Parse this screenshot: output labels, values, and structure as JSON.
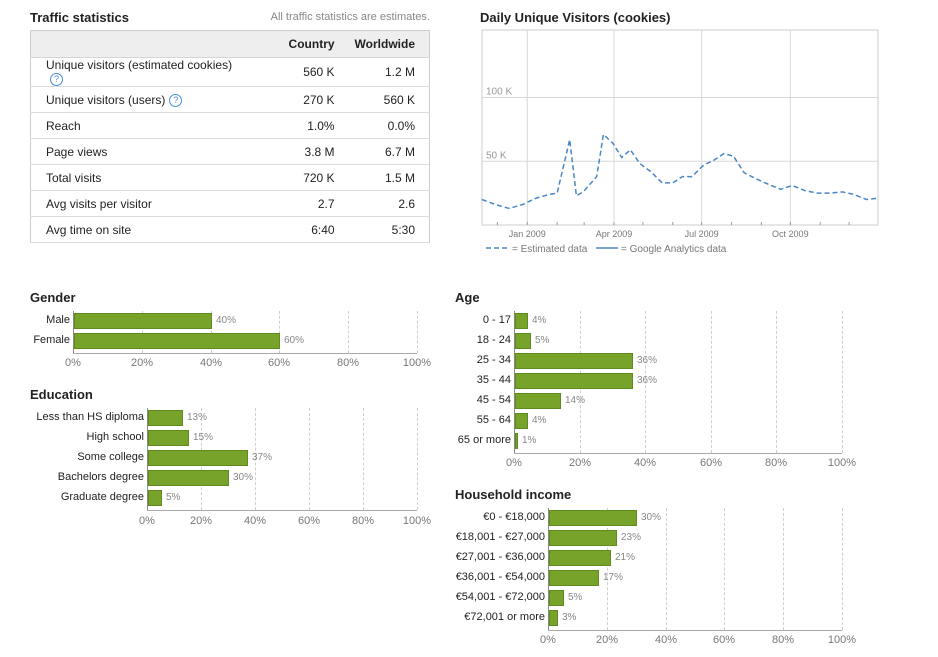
{
  "traffic": {
    "title": "Traffic statistics",
    "note": "All traffic statistics are estimates.",
    "columns": [
      "Country",
      "Worldwide"
    ],
    "rows": [
      {
        "label": "Unique visitors (estimated cookies)",
        "help": true,
        "country": "560 K",
        "worldwide": "1.2 M"
      },
      {
        "label": "Unique visitors (users)",
        "help": true,
        "country": "270 K",
        "worldwide": "560 K"
      },
      {
        "label": "Reach",
        "help": false,
        "country": "1.0%",
        "worldwide": "0.0%"
      },
      {
        "label": "Page views",
        "help": false,
        "country": "3.8 M",
        "worldwide": "6.7 M"
      },
      {
        "label": "Total visits",
        "help": false,
        "country": "720 K",
        "worldwide": "1.5 M"
      },
      {
        "label": "Avg visits per visitor",
        "help": false,
        "country": "2.7",
        "worldwide": "2.6"
      },
      {
        "label": "Avg time on site",
        "help": false,
        "country": "6:40",
        "worldwide": "5:30"
      }
    ],
    "help_icon": "question-mark-icon"
  },
  "colors": {
    "bar": "#77a32a",
    "line": "#4a86c5",
    "grid": "#cfcfcf"
  },
  "chart_data": [
    {
      "id": "daily-visitors",
      "type": "line",
      "title": "Daily Unique Visitors (cookies)",
      "y_tick_labels": [
        "50 K",
        "100 K"
      ],
      "y_ticks": [
        50,
        100
      ],
      "ylim": [
        0,
        153
      ],
      "x_tick_labels": [
        "Jan 2009",
        "Apr 2009",
        "Jul 2009",
        "Oct 2009"
      ],
      "x_ticks": [
        "2009-01-01",
        "2009-04-01",
        "2009-07-01",
        "2009-10-01"
      ],
      "x_range": [
        "2008-11-15",
        "2009-12-31"
      ],
      "grid": true,
      "legend": [
        "= Estimated data",
        "= Google Analytics data"
      ],
      "series": [
        {
          "name": "= Estimated data",
          "style": "dashed",
          "points": [
            [
              "2008-11-15",
              20
            ],
            [
              "2008-11-29",
              16
            ],
            [
              "2008-12-13",
              13
            ],
            [
              "2008-12-27",
              16
            ],
            [
              "2009-01-10",
              21
            ],
            [
              "2009-01-24",
              24
            ],
            [
              "2009-02-01",
              25
            ],
            [
              "2009-02-14",
              67
            ],
            [
              "2009-02-21",
              23
            ],
            [
              "2009-02-28",
              26
            ],
            [
              "2009-03-14",
              38
            ],
            [
              "2009-03-21",
              71
            ],
            [
              "2009-03-31",
              64
            ],
            [
              "2009-04-09",
              53
            ],
            [
              "2009-04-18",
              59
            ],
            [
              "2009-04-28",
              48
            ],
            [
              "2009-05-09",
              42
            ],
            [
              "2009-05-21",
              33
            ],
            [
              "2009-06-01",
              33
            ],
            [
              "2009-06-11",
              38
            ],
            [
              "2009-06-21",
              38
            ],
            [
              "2009-07-03",
              47
            ],
            [
              "2009-07-14",
              51
            ],
            [
              "2009-07-24",
              56
            ],
            [
              "2009-08-03",
              54
            ],
            [
              "2009-08-14",
              41
            ],
            [
              "2009-08-27",
              36
            ],
            [
              "2009-09-08",
              32
            ],
            [
              "2009-09-21",
              28
            ],
            [
              "2009-10-03",
              31
            ],
            [
              "2009-10-16",
              27
            ],
            [
              "2009-10-29",
              25
            ],
            [
              "2009-11-11",
              25
            ],
            [
              "2009-11-24",
              26
            ],
            [
              "2009-12-06",
              24
            ],
            [
              "2009-12-19",
              20
            ],
            [
              "2009-12-31",
              21
            ]
          ]
        }
      ]
    },
    {
      "id": "gender",
      "type": "bar",
      "orientation": "horizontal",
      "title": "Gender",
      "categories": [
        "Male",
        "Female"
      ],
      "values": [
        40,
        60
      ],
      "value_labels": [
        "40%",
        "60%"
      ],
      "ticks": [
        "0%",
        "20%",
        "40%",
        "60%",
        "80%",
        "100%"
      ],
      "xlim": [
        0,
        100
      ]
    },
    {
      "id": "education",
      "type": "bar",
      "orientation": "horizontal",
      "title": "Education",
      "categories": [
        "Less than HS diploma",
        "High school",
        "Some college",
        "Bachelors degree",
        "Graduate degree"
      ],
      "values": [
        13,
        15,
        37,
        30,
        5
      ],
      "value_labels": [
        "13%",
        "15%",
        "37%",
        "30%",
        "5%"
      ],
      "ticks": [
        "0%",
        "20%",
        "40%",
        "60%",
        "80%",
        "100%"
      ],
      "xlim": [
        0,
        100
      ]
    },
    {
      "id": "age",
      "type": "bar",
      "orientation": "horizontal",
      "title": "Age",
      "categories": [
        "0 - 17",
        "18 - 24",
        "25 - 34",
        "35 - 44",
        "45 - 54",
        "55 - 64",
        "65 or more"
      ],
      "values": [
        4,
        5,
        36,
        36,
        14,
        4,
        1
      ],
      "value_labels": [
        "4%",
        "5%",
        "36%",
        "36%",
        "14%",
        "4%",
        "1%"
      ],
      "ticks": [
        "0%",
        "20%",
        "40%",
        "60%",
        "80%",
        "100%"
      ],
      "xlim": [
        0,
        100
      ]
    },
    {
      "id": "income",
      "type": "bar",
      "orientation": "horizontal",
      "title": "Household income",
      "categories": [
        "€0 - €18,000",
        "€18,001 - €27,000",
        "€27,001 - €36,000",
        "€36,001 - €54,000",
        "€54,001 - €72,000",
        "€72,001 or more"
      ],
      "values": [
        30,
        23,
        21,
        17,
        5,
        3
      ],
      "value_labels": [
        "30%",
        "23%",
        "21%",
        "17%",
        "5%",
        "3%"
      ],
      "ticks": [
        "0%",
        "20%",
        "40%",
        "60%",
        "80%",
        "100%"
      ],
      "xlim": [
        0,
        100
      ]
    }
  ]
}
